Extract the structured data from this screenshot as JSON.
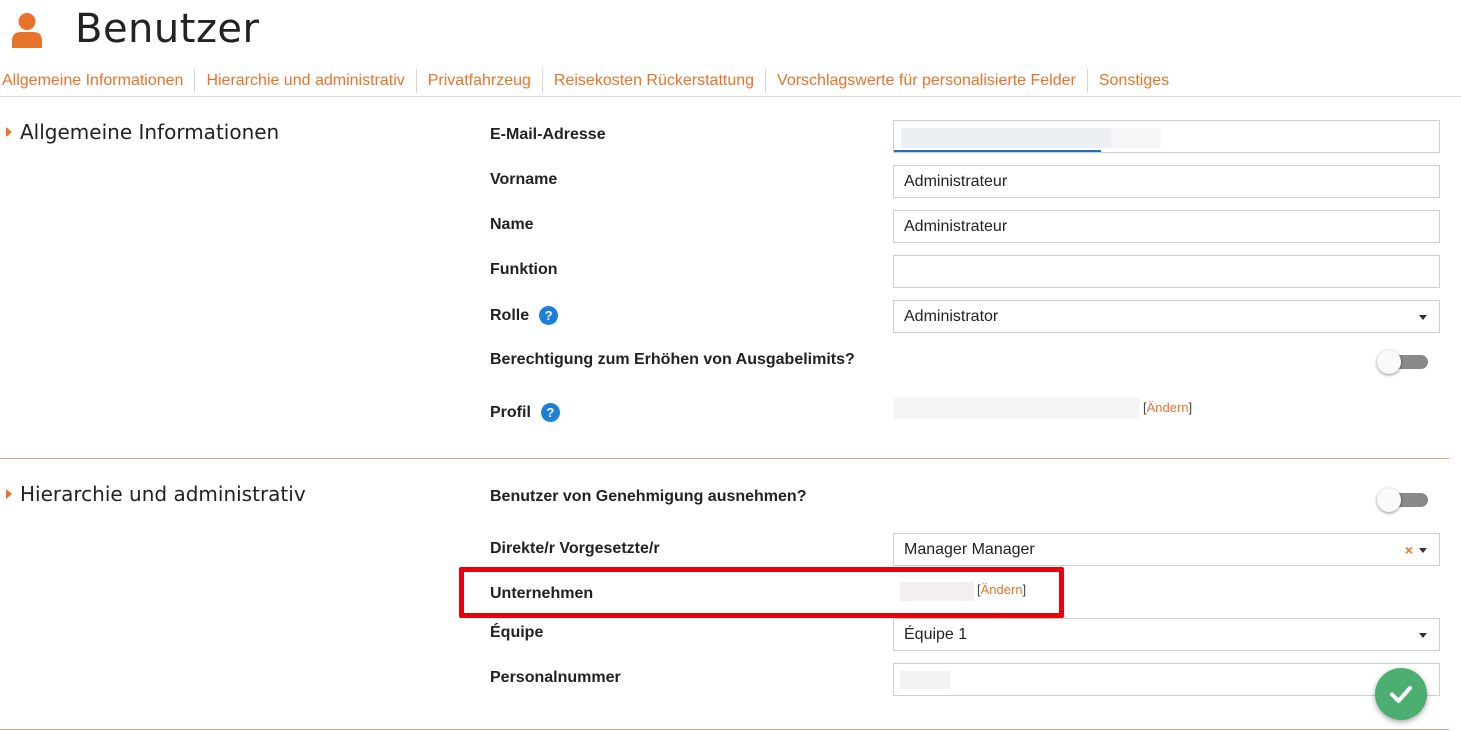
{
  "header": {
    "title": "Benutzer",
    "icon": "user-icon"
  },
  "tabs": [
    {
      "label": "Allgemeine Informationen"
    },
    {
      "label": "Hierarchie und administrativ"
    },
    {
      "label": "Privatfahrzeug"
    },
    {
      "label": "Reisekosten Rückerstattung"
    },
    {
      "label": "Vorschlagswerte für personalisierte Felder"
    },
    {
      "label": "Sonstiges"
    }
  ],
  "general": {
    "title": "Allgemeine Informationen",
    "email": {
      "label": "E-Mail-Adresse",
      "value": ""
    },
    "firstname": {
      "label": "Vorname",
      "value": "Administrateur"
    },
    "name": {
      "label": "Name",
      "value": "Administrateur"
    },
    "function": {
      "label": "Funktion",
      "value": ""
    },
    "role": {
      "label": "Rolle",
      "value": "Administrator",
      "help": "?"
    },
    "raise_limits": {
      "label": "Berechtigung zum Erhöhen von Ausgabelimits?",
      "on": false
    },
    "profile": {
      "label": "Profil",
      "help": "?",
      "change_open": "[",
      "change_label": "Ändern",
      "change_close": "]"
    }
  },
  "hierarchy": {
    "title": "Hierarchie und administrativ",
    "exempt": {
      "label": "Benutzer von Genehmigung ausnehmen?",
      "on": false
    },
    "manager": {
      "label": "Direkte/r Vorgesetzte/r",
      "value": "Manager Manager",
      "clear": "×"
    },
    "company": {
      "label": "Unternehmen",
      "change_open": "[",
      "change_label": "Ändern",
      "change_close": "]"
    },
    "team": {
      "label": "Équipe",
      "value": "Équipe 1"
    },
    "personnel_number": {
      "label": "Personalnummer",
      "value": ""
    }
  },
  "colors": {
    "accent": "#e8732a",
    "help": "#1e7fd8",
    "save": "#4cae70",
    "highlight": "#e8000a"
  }
}
